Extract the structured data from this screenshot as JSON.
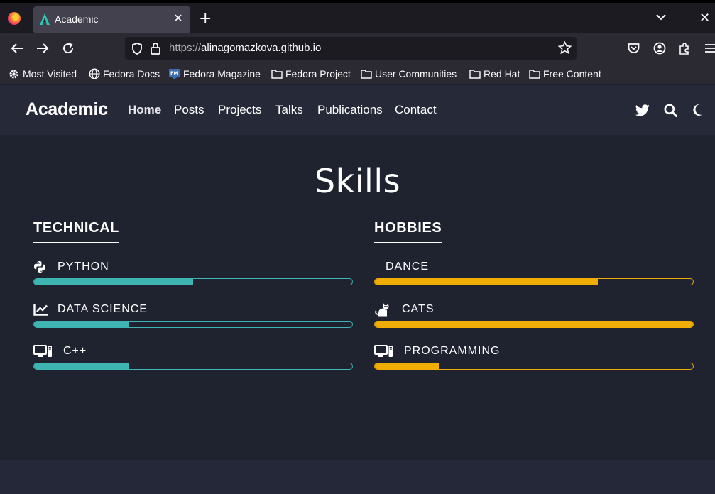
{
  "browser": {
    "tab_title": "Academic",
    "url_protocol": "https://",
    "url_host": "alinagomazkova.github.io",
    "bookmarks": [
      "Most Visited",
      "Fedora Docs",
      "Fedora Magazine",
      "Fedora Project",
      "User Communities",
      "Red Hat",
      "Free Content"
    ]
  },
  "site": {
    "brand": "Academic",
    "nav": [
      "Home",
      "Posts",
      "Projects",
      "Talks",
      "Publications",
      "Contact"
    ],
    "active_nav": "Home",
    "header_icons": [
      "twitter-icon",
      "search-icon",
      "moon-icon"
    ]
  },
  "skills": {
    "title": "Skills",
    "technical": {
      "heading": "TECHNICAL",
      "color": "#3fb5b3",
      "items": [
        {
          "name": "PYTHON",
          "icon": "python-icon",
          "level": 50
        },
        {
          "name": "DATA SCIENCE",
          "icon": "chart-line-icon",
          "level": 30
        },
        {
          "name": "C++",
          "icon": "desktop-icon",
          "level": 30
        }
      ]
    },
    "hobbies": {
      "heading": "HOBBIES",
      "color": "#f0ad06",
      "items": [
        {
          "name": "DANCE",
          "icon": "",
          "level": 70
        },
        {
          "name": "CATS",
          "icon": "cat-icon",
          "level": 100
        },
        {
          "name": "PROGRAMMING",
          "icon": "desktop-icon",
          "level": 20
        }
      ]
    }
  }
}
